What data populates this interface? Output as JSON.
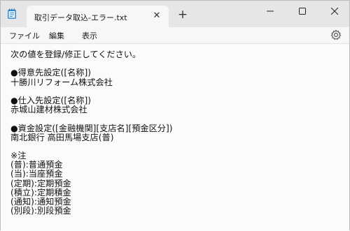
{
  "window": {
    "tab_title": "取引データ取込-エラー.txt",
    "close_tab": "✕",
    "new_tab": "+"
  },
  "menu": {
    "file": "ファイル",
    "edit": "編集",
    "view": "表示"
  },
  "document": {
    "lines": [
      "次の値を登録/修正してください。",
      "",
      "●得意先設定([名称])",
      "十勝川リフォーム株式会社",
      "",
      "●仕入先設定([名称])",
      "赤城山建材株式会社",
      "",
      "●資金設定([金融機関][支店名][預金区分])",
      "南北銀行 高田馬場支店(普)",
      "",
      "※注",
      "(普):普通預金",
      "(当):当座預金",
      "(定期):定期預金",
      "(積立):定期積金",
      "(通知):通知預金",
      "(別段):別段預金"
    ]
  },
  "icons": {
    "app": "notepad-icon",
    "settings": "gear-icon"
  }
}
